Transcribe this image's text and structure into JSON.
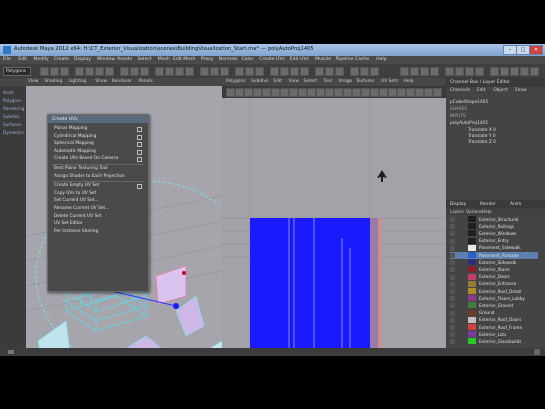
{
  "window": {
    "title": "Autodesk Maya 2012 x64: H:\\CT_Exterior_Visualization\\scenes\\BuildingVisualization_Start.ma* --- polyAutoProj1405",
    "minimize": "–",
    "maximize": "□",
    "close": "✕"
  },
  "menubar": {
    "items": [
      "File",
      "Edit",
      "Modify",
      "Create",
      "Display",
      "Window",
      "Assets",
      "Select",
      "Mesh",
      "Edit Mesh",
      "Proxy",
      "Normals",
      "Color",
      "Create UVs",
      "Edit UVs",
      "Muscle",
      "Pipeline Cache",
      "Help"
    ]
  },
  "shelf": {
    "mode": "Polygons"
  },
  "viewport": {
    "menus": [
      "View",
      "Shading",
      "Lighting",
      "Show",
      "Renderer",
      "Panels"
    ],
    "side_labels": [
      "Anim",
      "Polygons",
      "Rendering",
      "Subdivs",
      "Surfaces",
      "Dynamics"
    ],
    "camera_label": "persp"
  },
  "create_uvs_menu": {
    "title": "Create UVs",
    "items": [
      {
        "label": "Planar Mapping",
        "option": true
      },
      {
        "label": "Cylindrical Mapping",
        "option": true
      },
      {
        "label": "Spherical Mapping",
        "option": true
      },
      {
        "label": "Automatic Mapping",
        "option": true
      },
      {
        "label": "Create UVs Based On Camera",
        "option": true
      },
      {
        "label": "Best Plane Texturing Tool",
        "option": false
      },
      {
        "label": "Assign Shader to Each Projection",
        "option": false
      },
      {
        "label": "Create Empty UV Set",
        "option": true
      },
      {
        "label": "Copy UVs to UV Set",
        "option": false
      },
      {
        "label": "Set Current UV Set…",
        "option": false
      },
      {
        "label": "Rename Current UV Set…",
        "option": false
      },
      {
        "label": "Delete Current UV Set",
        "option": false
      },
      {
        "label": "UV Set Editor",
        "option": false
      },
      {
        "label": "Per Instance Sharing",
        "option": false
      }
    ]
  },
  "uv_editor": {
    "menus": [
      "Polygons",
      "Subdivs",
      "Edit",
      "View",
      "Select",
      "Tool",
      "Image",
      "Textures",
      "UV Sets",
      "Help"
    ]
  },
  "right_panel": {
    "header": "Channel Box / Layer Editor",
    "channel_tabs": [
      "Channels",
      "Edit",
      "Object",
      "Show"
    ],
    "object_name": "pCubeShape1405",
    "shape_label": "SHAPES",
    "inputs_label": "INPUTS",
    "input_node": "polyAutoProj1405",
    "attributes": [
      "Translate X 0",
      "Translate Y 0",
      "Translate Z 0"
    ],
    "layer_tabs": [
      "Display",
      "Render",
      "Anim"
    ],
    "layer_submenu": [
      "Layers",
      "Options",
      "Help"
    ],
    "layers": [
      {
        "name": "Exterior_Structural",
        "color": "#202020",
        "selected": false
      },
      {
        "name": "Exterior_Railings",
        "color": "#202020",
        "selected": false
      },
      {
        "name": "Exterior_Windows",
        "color": "#202020",
        "selected": false
      },
      {
        "name": "Exterior_Entry",
        "color": "#202020",
        "selected": false
      },
      {
        "name": "Pavement_Sidewalk",
        "color": "#e8e8e8",
        "selected": false
      },
      {
        "name": "Pavement_Parkade",
        "color": "#2f5fc8",
        "selected": true
      },
      {
        "name": "Exterior_Sidewalk",
        "color": "#2a2f7a",
        "selected": false
      },
      {
        "name": "Exterior_Stairs",
        "color": "#8a1e2a",
        "selected": false
      },
      {
        "name": "Exterior_Doors",
        "color": "#c23c6e",
        "selected": false
      },
      {
        "name": "Exterior_Entrance",
        "color": "#9a7a3a",
        "selected": false
      },
      {
        "name": "Exterior_Roof_Detail",
        "color": "#b08a2a",
        "selected": false
      },
      {
        "name": "Exterior_Floors_Lobby",
        "color": "#8a3a8a",
        "selected": false
      },
      {
        "name": "Exterior_Ground",
        "color": "#3f7f3f",
        "selected": false
      },
      {
        "name": "Ground",
        "color": "#6a3a2a",
        "selected": false
      },
      {
        "name": "Exterior_Roof_Doors",
        "color": "#c0c0c0",
        "selected": false
      },
      {
        "name": "Exterior_Roof_Frame",
        "color": "#d04040",
        "selected": false
      },
      {
        "name": "Exterior_Lots",
        "color": "#7a3aa0",
        "selected": false
      },
      {
        "name": "Exterior_Glassbuilds",
        "color": "#28c828",
        "selected": false
      }
    ]
  },
  "colors": {
    "uv_blue": "#1a1aff",
    "viewport_bg": "#a6a5ac",
    "selection_cyan": "#7ae8f0",
    "selected_layer": "#5c7fb0"
  }
}
